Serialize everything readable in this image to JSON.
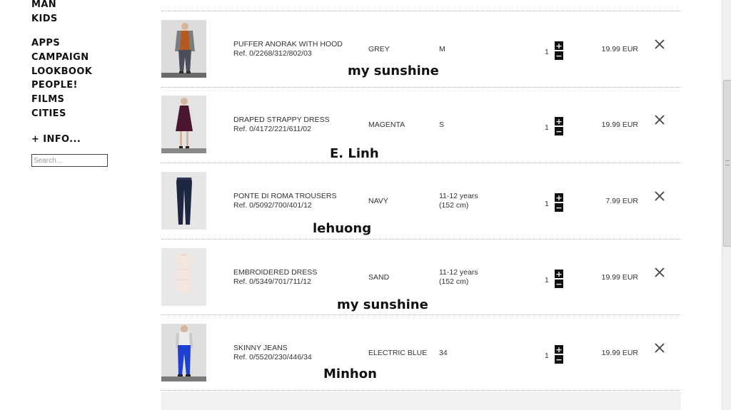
{
  "sidebar": {
    "nav_top": [
      "MAN",
      "KIDS"
    ],
    "nav_main": [
      "APPS",
      "CAMPAIGN",
      "LOOKBOOK",
      "PEOPLE!",
      "FILMS",
      "CITIES"
    ],
    "info_label": "+ INFO...",
    "search_placeholder": "Search..."
  },
  "cart": {
    "items": [
      {
        "name": "PUFFER ANORAK WITH HOOD",
        "ref": "Ref. 0/2268/312/802/03",
        "color": "GREY",
        "size_line1": "M",
        "size_line2": "",
        "qty": "1",
        "price": "19.99 EUR",
        "watermark": "my sunshine",
        "thumb": "puffer-anorak-icon"
      },
      {
        "name": "DRAPED STRAPPY DRESS",
        "ref": "Ref. 0/4172/221/611/02",
        "color": "MAGENTA",
        "size_line1": "S",
        "size_line2": "",
        "qty": "1",
        "price": "19.99 EUR",
        "watermark": "E. Linh",
        "thumb": "strappy-dress-icon"
      },
      {
        "name": "PONTE DI ROMA TROUSERS",
        "ref": "Ref. 0/5092/700/401/12",
        "color": "NAVY",
        "size_line1": "11-12 years",
        "size_line2": "(152 cm)",
        "qty": "1",
        "price": "7.99 EUR",
        "watermark": "lehuong",
        "thumb": "trousers-icon"
      },
      {
        "name": "EMBROIDERED DRESS",
        "ref": "Ref. 0/5349/701/711/12",
        "color": "SAND",
        "size_line1": "11-12 years",
        "size_line2": "(152 cm)",
        "qty": "1",
        "price": "19.99 EUR",
        "watermark": "my sunshine",
        "thumb": "embroidered-dress-icon"
      },
      {
        "name": "SKINNY JEANS",
        "ref": "Ref. 0/5520/230/446/34",
        "color": "ELECTRIC BLUE",
        "size_line1": "34",
        "size_line2": "",
        "qty": "1",
        "price": "19.99 EUR",
        "watermark": "Minhon",
        "thumb": "skinny-jeans-icon"
      }
    ],
    "plus_symbol": "+",
    "minus_symbol": "−"
  },
  "colors": {
    "anorak": "#b5591f",
    "dress_magenta": "#4a1630",
    "trousers_navy": "#1d2740",
    "dress_sand": "#f3e6df",
    "jeans_blue": "#1f3fd0"
  }
}
